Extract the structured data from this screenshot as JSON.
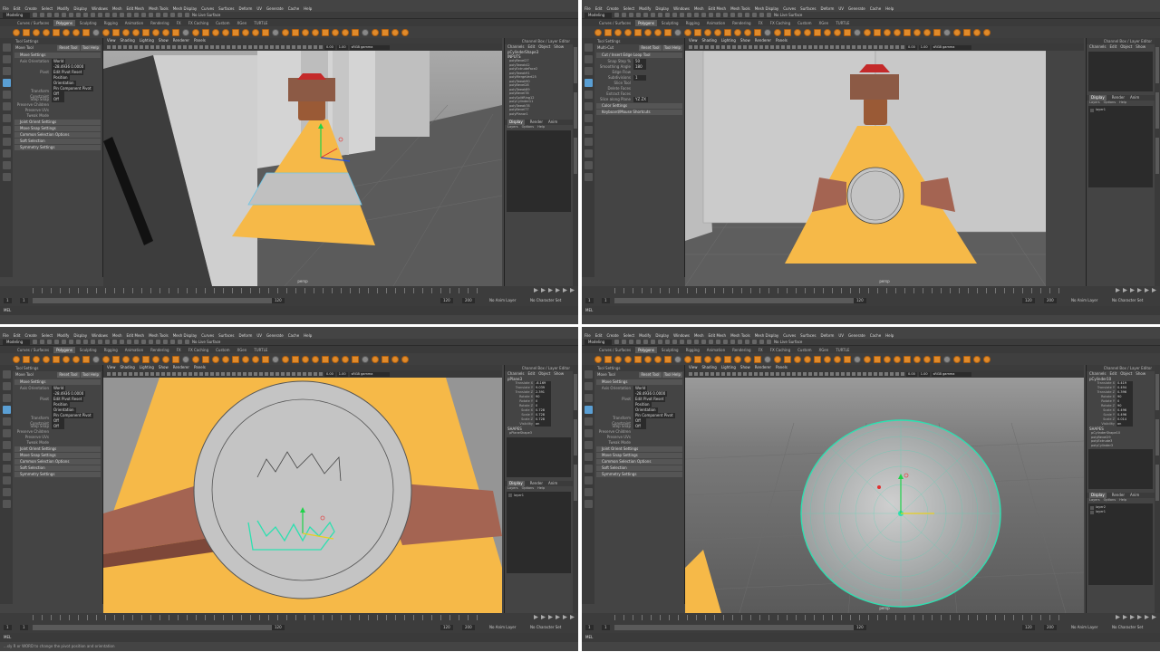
{
  "panels": [
    {
      "id": "tl",
      "menus": [
        "File",
        "Edit",
        "Create",
        "Select",
        "Modify",
        "Display",
        "Windows",
        "Mesh",
        "Edit Mesh",
        "Mesh Tools",
        "Mesh Display",
        "Curves",
        "Surfaces",
        "Deform",
        "UV",
        "Generate",
        "Cache",
        "Help"
      ],
      "mode": "Modeling",
      "live": "No Live Surface",
      "shelf_tabs": [
        "Curves / Surfaces",
        "Polygons",
        "Sculpting",
        "Rigging",
        "Animation",
        "Rendering",
        "FX",
        "FX Caching",
        "Custom",
        "XGen",
        "TURTLE"
      ],
      "active_tab": "Polygons",
      "tool_header": "Tool Settings",
      "tool_name": "Move Tool",
      "reset_label": "Reset Tool",
      "help_label": "Tool Help",
      "sections_top": [
        "Move Settings"
      ],
      "rows": [
        {
          "k": "Axis Orientation",
          "v": "World"
        },
        {
          "k": "",
          "v": "-28.4936   0.0000"
        },
        {
          "k": "Pivot",
          "v": "Edit Pivot   Reset"
        },
        {
          "k": "",
          "v": "Position"
        },
        {
          "k": "",
          "v": "Orientation"
        },
        {
          "k": "",
          "v": "Pin Component Pivot"
        },
        {
          "k": "Transform Constraint",
          "v": "Off"
        },
        {
          "k": "Step Snap",
          "v": "Off"
        },
        {
          "k": "Preserve Children",
          "v": ""
        },
        {
          "k": "Preserve UVs",
          "v": ""
        },
        {
          "k": "Tweak Mode",
          "v": ""
        }
      ],
      "sections_bottom": [
        "Joint Orient Settings",
        "Move Snap Settings",
        "Common Selection Options",
        "Soft Selection",
        "Symmetry Settings"
      ],
      "vp_menu": [
        "View",
        "Shading",
        "Lighting",
        "Show",
        "Renderer",
        "Panels"
      ],
      "vp_values": [
        "0.00",
        "1.00"
      ],
      "colorspace": "sRGB gamma",
      "cam": "persp",
      "chbox_header": "Channel Box / Layer Editor",
      "ch_tabs": [
        "Channels",
        "Edit",
        "Object",
        "Show"
      ],
      "object": "pCylinderShape3",
      "inputs_label": "INPUTS",
      "inputs": [
        "polyBevel27",
        "polyTweak42",
        "polyExtrudeFace2",
        "polyTweak91",
        "polyMergeVert25",
        "polyTweak90",
        "polyBevel28",
        "polyTweak89",
        "polyBevel78",
        "polySplitRing12",
        "polyCylinder11",
        "polyTweak78",
        "polyBevel77",
        "polyPlanar1"
      ],
      "attrs": [],
      "layer_tabs": [
        "Display",
        "Render",
        "Anim"
      ],
      "layer_menu": [
        "Layers",
        "Options",
        "Help"
      ],
      "layers": [],
      "range": [
        "1",
        "1",
        "120",
        "120",
        "200"
      ],
      "no_anim": "No Anim Layer",
      "no_char": "No Character Set",
      "mel": "MEL",
      "help_text": ""
    },
    {
      "id": "tr",
      "menus": [
        "File",
        "Edit",
        "Create",
        "Select",
        "Modify",
        "Display",
        "Windows",
        "Mesh",
        "Edit Mesh",
        "Mesh Tools",
        "Mesh Display",
        "Curves",
        "Surfaces",
        "Deform",
        "UV",
        "Generate",
        "Cache",
        "Help"
      ],
      "mode": "Modeling",
      "live": "No Live Surface",
      "shelf_tabs": [
        "Curves / Surfaces",
        "Polygons",
        "Sculpting",
        "Rigging",
        "Animation",
        "Rendering",
        "FX",
        "FX Caching",
        "Custom",
        "XGen",
        "TURTLE"
      ],
      "active_tab": "Polygons",
      "tool_header": "Tool Settings",
      "tool_name": "Multi-Cut",
      "reset_label": "Reset Tool",
      "help_label": "Tool Help",
      "sections_top": [
        "Cut / Insert Edge Loop Tool"
      ],
      "rows": [
        {
          "k": "Snap Step %",
          "v": "50"
        },
        {
          "k": "Smoothing Angle",
          "v": "180"
        },
        {
          "k": "Edge Flow",
          "v": ""
        },
        {
          "k": "Subdivisions",
          "v": "1"
        },
        {
          "k": "Slice Tool",
          "v": ""
        },
        {
          "k": "Delete Faces",
          "v": ""
        },
        {
          "k": "Extract Faces",
          "v": ""
        },
        {
          "k": "Slice along Plane",
          "v": "YZ   ZX"
        }
      ],
      "sections_bottom": [
        "Color Settings",
        "Keyboard/Mouse Shortcuts"
      ],
      "vp_menu": [
        "View",
        "Shading",
        "Lighting",
        "Show",
        "Renderer",
        "Panels"
      ],
      "vp_values": [
        "0.00",
        "1.00"
      ],
      "colorspace": "sRGB gamma",
      "cam": "persp",
      "chbox_header": "Channel Box / Layer Editor",
      "ch_tabs": [
        "Channels",
        "Edit",
        "Object",
        "Show"
      ],
      "object": "",
      "inputs_label": "",
      "inputs": [],
      "attrs": [],
      "layer_tabs": [
        "Display",
        "Render",
        "Anim"
      ],
      "layer_menu": [
        "Layers",
        "Options",
        "Help"
      ],
      "layers": [
        "layer1"
      ],
      "range": [
        "1",
        "1",
        "120",
        "120",
        "200"
      ],
      "no_anim": "No Anim Layer",
      "no_char": "No Character Set",
      "mel": "MEL",
      "help_text": ""
    },
    {
      "id": "bl",
      "menus": [
        "File",
        "Edit",
        "Create",
        "Select",
        "Modify",
        "Display",
        "Windows",
        "Mesh",
        "Edit Mesh",
        "Mesh Tools",
        "Mesh Display",
        "Curves",
        "Surfaces",
        "Deform",
        "UV",
        "Generate",
        "Cache",
        "Help"
      ],
      "mode": "Modeling",
      "live": "No Live Surface",
      "shelf_tabs": [
        "Curves / Surfaces",
        "Polygons",
        "Sculpting",
        "Rigging",
        "Animation",
        "Rendering",
        "FX",
        "FX Caching",
        "Custom",
        "XGen",
        "TURTLE"
      ],
      "active_tab": "Polygons",
      "tool_header": "Tool Settings",
      "tool_name": "Move Tool",
      "reset_label": "Reset Tool",
      "help_label": "Tool Help",
      "sections_top": [
        "Move Settings"
      ],
      "rows": [
        {
          "k": "Axis Orientation",
          "v": "World"
        },
        {
          "k": "",
          "v": "-28.4936   0.0000"
        },
        {
          "k": "Pivot",
          "v": "Edit Pivot   Reset"
        },
        {
          "k": "",
          "v": "Position"
        },
        {
          "k": "",
          "v": "Orientation"
        },
        {
          "k": "",
          "v": "Pin Component Pivot"
        },
        {
          "k": "Transform Constraint",
          "v": "Off"
        },
        {
          "k": "Step Snap",
          "v": "Off"
        },
        {
          "k": "Preserve Children",
          "v": ""
        },
        {
          "k": "Preserve UVs",
          "v": ""
        },
        {
          "k": "Tweak Mode",
          "v": ""
        }
      ],
      "sections_bottom": [
        "Joint Orient Settings",
        "Move Snap Settings",
        "Common Selection Options",
        "Soft Selection",
        "Symmetry Settings"
      ],
      "vp_menu": [
        "View",
        "Shading",
        "Lighting",
        "Show",
        "Renderer",
        "Panels"
      ],
      "vp_values": [
        "0.00",
        "1.00"
      ],
      "colorspace": "sRGB gamma",
      "cam": "",
      "chbox_header": "Channel Box / Layer Editor",
      "ch_tabs": [
        "Channels",
        "Edit",
        "Object",
        "Show"
      ],
      "object": "pPlane3",
      "inputs_label": "SHAPES",
      "inputs": [
        "pPlaneShape3"
      ],
      "attrs": [
        {
          "k": "Translate X",
          "v": "-6.169"
        },
        {
          "k": "Translate Y",
          "v": "9.039"
        },
        {
          "k": "Translate Z",
          "v": "2.391"
        },
        {
          "k": "Rotate X",
          "v": "90"
        },
        {
          "k": "Rotate Y",
          "v": "0"
        },
        {
          "k": "Rotate Z",
          "v": "0"
        },
        {
          "k": "Scale X",
          "v": "0.728"
        },
        {
          "k": "Scale Y",
          "v": "0.728"
        },
        {
          "k": "Scale Z",
          "v": "0.728"
        },
        {
          "k": "Visibility",
          "v": "on"
        }
      ],
      "layer_tabs": [
        "Display",
        "Render",
        "Anim"
      ],
      "layer_menu": [
        "Layers",
        "Options",
        "Help"
      ],
      "layers": [
        "layer1"
      ],
      "range": [
        "1",
        "1",
        "120",
        "120",
        "200"
      ],
      "no_anim": "No Anim Layer",
      "no_char": "No Character Set",
      "mel": "MEL",
      "help_text": "...sly R or WORD to change the pivot position and orientation"
    },
    {
      "id": "br",
      "menus": [
        "File",
        "Edit",
        "Create",
        "Select",
        "Modify",
        "Display",
        "Windows",
        "Mesh",
        "Edit Mesh",
        "Mesh Tools",
        "Mesh Display",
        "Curves",
        "Surfaces",
        "Deform",
        "UV",
        "Generate",
        "Cache",
        "Help"
      ],
      "mode": "Modeling",
      "live": "No Live Surface",
      "shelf_tabs": [
        "Curves / Surfaces",
        "Polygons",
        "Sculpting",
        "Rigging",
        "Animation",
        "Rendering",
        "FX",
        "FX Caching",
        "Custom",
        "XGen",
        "TURTLE"
      ],
      "active_tab": "Polygons",
      "tool_header": "Tool Settings",
      "tool_name": "Move Tool",
      "reset_label": "Reset Tool",
      "help_label": "Tool Help",
      "sections_top": [
        "Move Settings"
      ],
      "rows": [
        {
          "k": "Axis Orientation",
          "v": "World"
        },
        {
          "k": "",
          "v": "-28.4936   0.0000"
        },
        {
          "k": "Pivot",
          "v": "Edit Pivot   Reset"
        },
        {
          "k": "",
          "v": "Position"
        },
        {
          "k": "",
          "v": "Orientation"
        },
        {
          "k": "",
          "v": "Pin Component Pivot"
        },
        {
          "k": "Transform Constraint",
          "v": "Off"
        },
        {
          "k": "Step Snap",
          "v": "Off"
        },
        {
          "k": "Preserve Children",
          "v": ""
        },
        {
          "k": "Preserve UVs",
          "v": ""
        },
        {
          "k": "Tweak Mode",
          "v": ""
        }
      ],
      "sections_bottom": [
        "Joint Orient Settings",
        "Move Snap Settings",
        "Common Selection Options",
        "Soft Selection",
        "Symmetry Settings"
      ],
      "vp_menu": [
        "View",
        "Shading",
        "Lighting",
        "Show",
        "Renderer",
        "Panels"
      ],
      "vp_values": [
        "0.00",
        "1.00"
      ],
      "colorspace": "sRGB gamma",
      "cam": "persp",
      "chbox_header": "Channel Box / Layer Editor",
      "ch_tabs": [
        "Channels",
        "Edit",
        "Object",
        "Show"
      ],
      "object": "pCylinder10",
      "inputs_label": "SHAPES",
      "inputs": [
        "pCylinderShape10",
        "polyBevel29",
        "polyExtrude3",
        "polyCylinder3"
      ],
      "attrs": [
        {
          "k": "Translate X",
          "v": "0.419"
        },
        {
          "k": "Translate Y",
          "v": "0.494"
        },
        {
          "k": "Translate Z",
          "v": "0.396"
        },
        {
          "k": "Rotate X",
          "v": "90"
        },
        {
          "k": "Rotate Y",
          "v": "0"
        },
        {
          "k": "Rotate Z",
          "v": "90"
        },
        {
          "k": "Scale X",
          "v": "0.496"
        },
        {
          "k": "Scale Y",
          "v": "0.496"
        },
        {
          "k": "Scale Z",
          "v": "0.014"
        },
        {
          "k": "Visibility",
          "v": "on"
        }
      ],
      "layer_tabs": [
        "Display",
        "Render",
        "Anim"
      ],
      "layer_menu": [
        "Layers",
        "Options",
        "Help"
      ],
      "layers": [
        "layer2",
        "layer1"
      ],
      "range": [
        "1",
        "1",
        "120",
        "120",
        "200"
      ],
      "no_anim": "No Anim Layer",
      "no_char": "No Character Set",
      "mel": "MEL",
      "help_text": ""
    }
  ],
  "colors": {
    "ui_bg": "#444444",
    "accent_orange": "#e08a2a",
    "gradient_top": "#a5a5a5",
    "floor": "#5d5d5d",
    "cone_yellow": "#f6b948",
    "band_brown": "#a46452",
    "selection_cyan": "#2de0b0"
  }
}
